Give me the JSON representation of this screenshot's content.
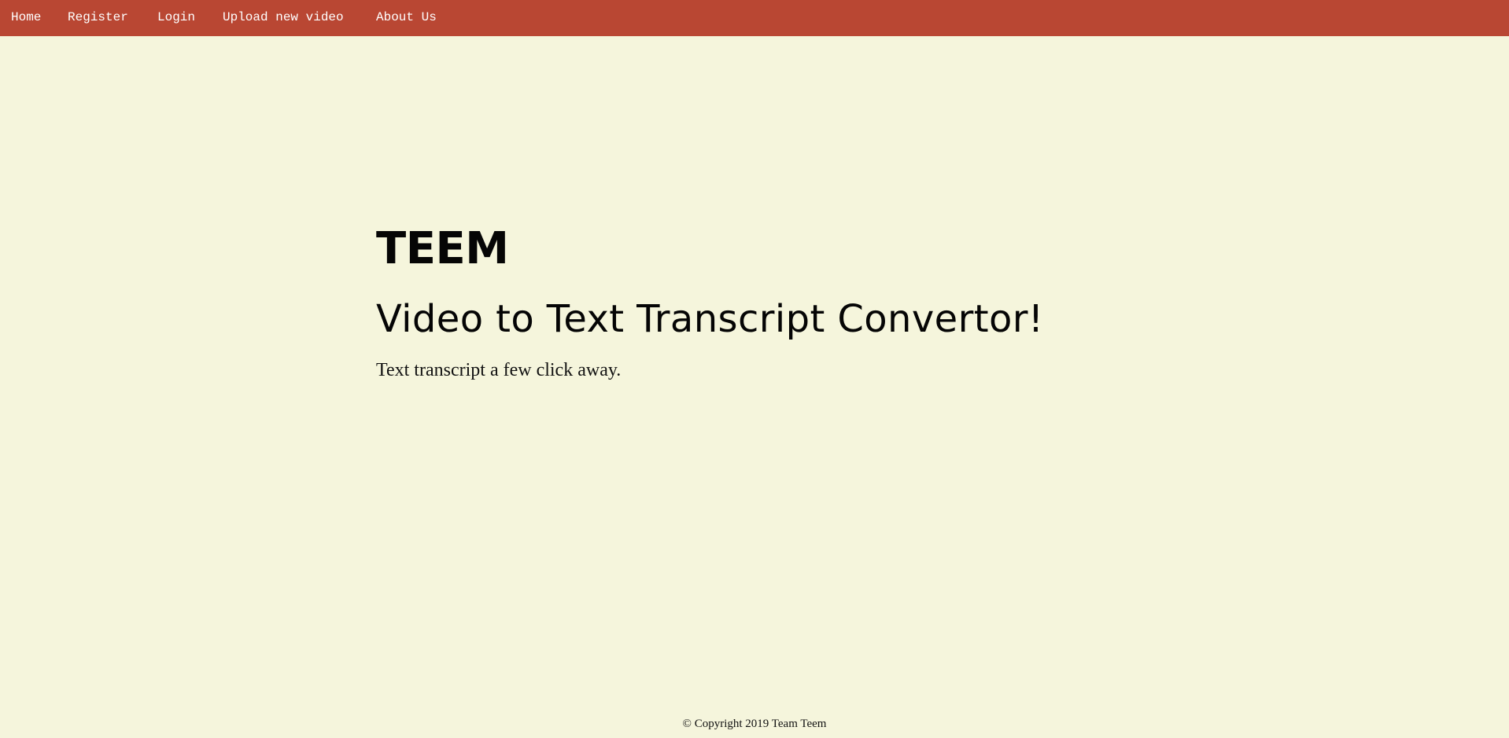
{
  "navbar": {
    "items": [
      {
        "label": "Home"
      },
      {
        "label": "Register"
      },
      {
        "label": "Login"
      },
      {
        "label": "Upload new video"
      },
      {
        "label": "About Us"
      }
    ],
    "background_color": "#b94733",
    "text_color": "#ffffff"
  },
  "hero": {
    "brand": "TEEM",
    "headline": "Video to Text Transcript Convertor!",
    "tagline": "Text transcript a few click away."
  },
  "footer": {
    "copyright": "© Copyright 2019 Team Teem"
  },
  "page": {
    "background_color": "#f5f5dc"
  }
}
